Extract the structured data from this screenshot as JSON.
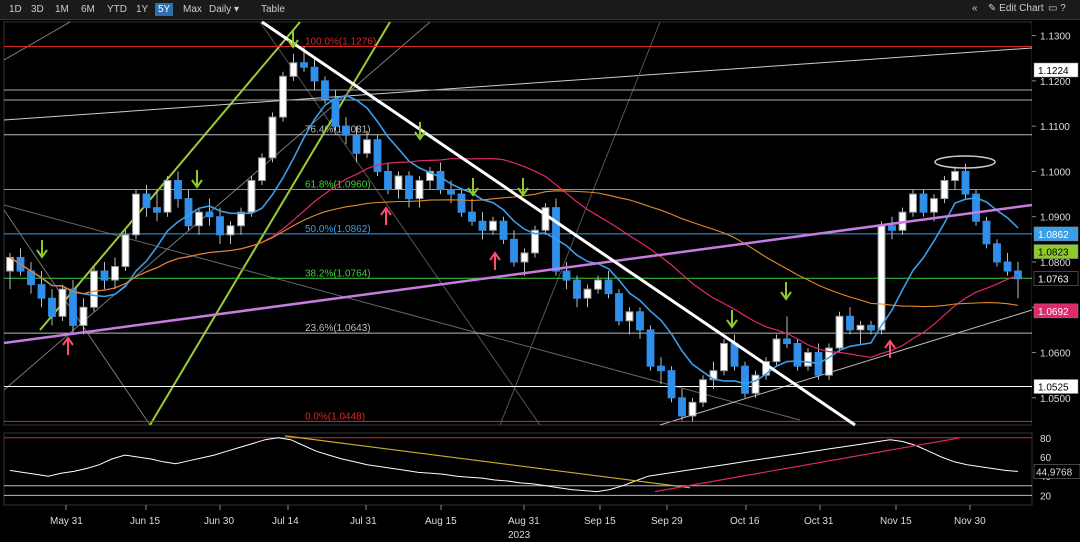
{
  "toolbar": {
    "ranges": [
      "1D",
      "3D",
      "1M",
      "6M",
      "YTD",
      "1Y",
      "5Y",
      "Max"
    ],
    "active_range": "5Y",
    "interval": "Daily",
    "interval_arrow": "▾",
    "table": "Table",
    "collapse": "«",
    "edit_chart": "✎ Edit Chart",
    "window_icons": "▭ ?"
  },
  "chart_data": {
    "type": "candlestick",
    "x_ticks": [
      "May 31",
      "Jun 15",
      "Jun 30",
      "Jul 14",
      "Jul 31",
      "Aug 15",
      "Aug 31",
      "Sep 15",
      "Sep 29",
      "Oct 16",
      "Oct 31",
      "Nov 15",
      "Nov 30"
    ],
    "year_label": "2023",
    "price_axis": {
      "ylim": [
        1.044,
        1.133
      ],
      "ticks": [
        "1.1300",
        "1.1200",
        "1.1100",
        "1.1000",
        "1.0900",
        "1.0800",
        "1.0700",
        "1.0600",
        "1.0500"
      ]
    },
    "price_badges": [
      {
        "value": "1.1224",
        "color": "#ffffff",
        "text_color": "#000000"
      },
      {
        "value": "1.0862",
        "color": "#3a9ee8",
        "text_color": "#ffffff"
      },
      {
        "value": "1.0823",
        "color": "#8ecb2a",
        "text_color": "#000000"
      },
      {
        "value": "1.0763",
        "color": "#000000",
        "text_color": "#ffffff"
      },
      {
        "value": "1.0692",
        "color": "#e0286c",
        "text_color": "#ffffff"
      },
      {
        "value": "1.0525",
        "color": "#ffffff",
        "text_color": "#000000"
      }
    ],
    "fib_levels": [
      {
        "label": "100.0%(1.1276)",
        "value": 1.1276,
        "color": "#d8282a"
      },
      {
        "label": "76.4%(1.1081)",
        "value": 1.1081,
        "color": "#bbbbbb"
      },
      {
        "label": "61.8%(1.0960)",
        "value": 1.096,
        "color": "#3bcf3b"
      },
      {
        "label": "50.0%(1.0862)",
        "value": 1.0862,
        "color": "#3a9ee8"
      },
      {
        "label": "38.2%(1.0764)",
        "value": 1.0764,
        "color": "#3bcf3b"
      },
      {
        "label": "23.6%(1.0643)",
        "value": 1.0643,
        "color": "#bbbbbb"
      },
      {
        "label": "0.0%(1.0448)",
        "value": 1.0448,
        "color": "#d8282a"
      }
    ],
    "candles": [
      [
        1.078,
        1.082,
        1.074,
        1.081
      ],
      [
        1.081,
        1.083,
        1.077,
        1.078
      ],
      [
        1.078,
        1.08,
        1.073,
        1.075
      ],
      [
        1.075,
        1.078,
        1.07,
        1.072
      ],
      [
        1.072,
        1.074,
        1.066,
        1.068
      ],
      [
        1.068,
        1.075,
        1.067,
        1.074
      ],
      [
        1.074,
        1.076,
        1.064,
        1.066
      ],
      [
        1.066,
        1.072,
        1.064,
        1.07
      ],
      [
        1.07,
        1.079,
        1.069,
        1.078
      ],
      [
        1.078,
        1.08,
        1.074,
        1.076
      ],
      [
        1.076,
        1.081,
        1.074,
        1.079
      ],
      [
        1.079,
        1.087,
        1.078,
        1.086
      ],
      [
        1.086,
        1.096,
        1.085,
        1.095
      ],
      [
        1.095,
        1.097,
        1.09,
        1.092
      ],
      [
        1.092,
        1.096,
        1.089,
        1.091
      ],
      [
        1.091,
        1.099,
        1.09,
        1.098
      ],
      [
        1.098,
        1.1,
        1.092,
        1.094
      ],
      [
        1.094,
        1.096,
        1.087,
        1.088
      ],
      [
        1.088,
        1.092,
        1.086,
        1.091
      ],
      [
        1.091,
        1.094,
        1.088,
        1.09
      ],
      [
        1.09,
        1.092,
        1.084,
        1.086
      ],
      [
        1.086,
        1.089,
        1.084,
        1.088
      ],
      [
        1.088,
        1.092,
        1.086,
        1.091
      ],
      [
        1.091,
        1.099,
        1.09,
        1.098
      ],
      [
        1.098,
        1.104,
        1.097,
        1.103
      ],
      [
        1.103,
        1.113,
        1.102,
        1.112
      ],
      [
        1.112,
        1.122,
        1.111,
        1.121
      ],
      [
        1.121,
        1.126,
        1.12,
        1.124
      ],
      [
        1.124,
        1.1276,
        1.122,
        1.123
      ],
      [
        1.123,
        1.125,
        1.118,
        1.12
      ],
      [
        1.12,
        1.121,
        1.115,
        1.116
      ],
      [
        1.116,
        1.118,
        1.109,
        1.11
      ],
      [
        1.11,
        1.112,
        1.106,
        1.108
      ],
      [
        1.108,
        1.11,
        1.102,
        1.104
      ],
      [
        1.104,
        1.109,
        1.103,
        1.107
      ],
      [
        1.107,
        1.108,
        1.099,
        1.1
      ],
      [
        1.1,
        1.102,
        1.095,
        1.096
      ],
      [
        1.096,
        1.1,
        1.094,
        1.099
      ],
      [
        1.099,
        1.1,
        1.092,
        1.094
      ],
      [
        1.094,
        1.099,
        1.092,
        1.098
      ],
      [
        1.098,
        1.101,
        1.096,
        1.1
      ],
      [
        1.1,
        1.102,
        1.095,
        1.096
      ],
      [
        1.096,
        1.098,
        1.093,
        1.095
      ],
      [
        1.095,
        1.096,
        1.09,
        1.091
      ],
      [
        1.091,
        1.094,
        1.088,
        1.089
      ],
      [
        1.089,
        1.091,
        1.085,
        1.087
      ],
      [
        1.087,
        1.09,
        1.086,
        1.089
      ],
      [
        1.089,
        1.09,
        1.084,
        1.085
      ],
      [
        1.085,
        1.087,
        1.079,
        1.08
      ],
      [
        1.08,
        1.083,
        1.077,
        1.082
      ],
      [
        1.082,
        1.088,
        1.081,
        1.087
      ],
      [
        1.087,
        1.093,
        1.086,
        1.092
      ],
      [
        1.092,
        1.094,
        1.077,
        1.078
      ],
      [
        1.078,
        1.08,
        1.074,
        1.076
      ],
      [
        1.076,
        1.077,
        1.07,
        1.072
      ],
      [
        1.072,
        1.075,
        1.07,
        1.074
      ],
      [
        1.074,
        1.077,
        1.073,
        1.076
      ],
      [
        1.076,
        1.078,
        1.072,
        1.073
      ],
      [
        1.073,
        1.074,
        1.066,
        1.067
      ],
      [
        1.067,
        1.07,
        1.064,
        1.069
      ],
      [
        1.069,
        1.07,
        1.063,
        1.065
      ],
      [
        1.065,
        1.066,
        1.056,
        1.057
      ],
      [
        1.057,
        1.059,
        1.053,
        1.056
      ],
      [
        1.056,
        1.057,
        1.049,
        1.05
      ],
      [
        1.05,
        1.052,
        1.045,
        1.046
      ],
      [
        1.046,
        1.05,
        1.0448,
        1.049
      ],
      [
        1.049,
        1.055,
        1.048,
        1.054
      ],
      [
        1.054,
        1.058,
        1.052,
        1.056
      ],
      [
        1.056,
        1.063,
        1.055,
        1.062
      ],
      [
        1.062,
        1.064,
        1.056,
        1.057
      ],
      [
        1.057,
        1.058,
        1.05,
        1.051
      ],
      [
        1.051,
        1.056,
        1.05,
        1.055
      ],
      [
        1.055,
        1.059,
        1.054,
        1.058
      ],
      [
        1.058,
        1.064,
        1.057,
        1.063
      ],
      [
        1.063,
        1.068,
        1.061,
        1.062
      ],
      [
        1.062,
        1.063,
        1.056,
        1.057
      ],
      [
        1.057,
        1.061,
        1.056,
        1.06
      ],
      [
        1.06,
        1.062,
        1.054,
        1.055
      ],
      [
        1.055,
        1.062,
        1.054,
        1.061
      ],
      [
        1.061,
        1.069,
        1.06,
        1.068
      ],
      [
        1.068,
        1.07,
        1.064,
        1.065
      ],
      [
        1.065,
        1.067,
        1.062,
        1.066
      ],
      [
        1.066,
        1.067,
        1.064,
        1.065
      ],
      [
        1.065,
        1.089,
        1.064,
        1.088
      ],
      [
        1.088,
        1.09,
        1.085,
        1.087
      ],
      [
        1.087,
        1.092,
        1.086,
        1.091
      ],
      [
        1.091,
        1.096,
        1.09,
        1.095
      ],
      [
        1.095,
        1.096,
        1.09,
        1.091
      ],
      [
        1.091,
        1.095,
        1.089,
        1.094
      ],
      [
        1.094,
        1.099,
        1.093,
        1.098
      ],
      [
        1.098,
        1.101,
        1.096,
        1.1
      ],
      [
        1.1,
        1.1017,
        1.094,
        1.095
      ],
      [
        1.095,
        1.096,
        1.088,
        1.089
      ],
      [
        1.089,
        1.09,
        1.083,
        1.084
      ],
      [
        1.084,
        1.085,
        1.079,
        1.08
      ],
      [
        1.08,
        1.082,
        1.077,
        1.078
      ],
      [
        1.078,
        1.08,
        1.072,
        1.0763
      ]
    ],
    "rsi_panel": {
      "ticks": [
        "80",
        "60",
        "40",
        "20"
      ],
      "value_badge": "44.9768",
      "values": [
        46,
        44,
        42,
        40,
        43,
        45,
        48,
        52,
        58,
        62,
        60,
        58,
        55,
        53,
        56,
        59,
        62,
        66,
        70,
        74,
        78,
        80,
        78,
        72,
        66,
        62,
        58,
        55,
        52,
        50,
        48,
        46,
        44,
        43,
        42,
        40,
        39,
        38,
        36,
        35,
        33,
        32,
        30,
        28,
        26,
        25,
        24,
        26,
        30,
        35,
        40,
        42,
        44,
        46,
        48,
        50,
        52,
        54,
        56,
        58,
        60,
        62,
        64,
        66,
        68,
        70,
        72,
        74,
        76,
        78,
        76,
        72,
        66,
        60,
        55,
        52,
        50,
        48,
        46,
        45
      ]
    }
  }
}
